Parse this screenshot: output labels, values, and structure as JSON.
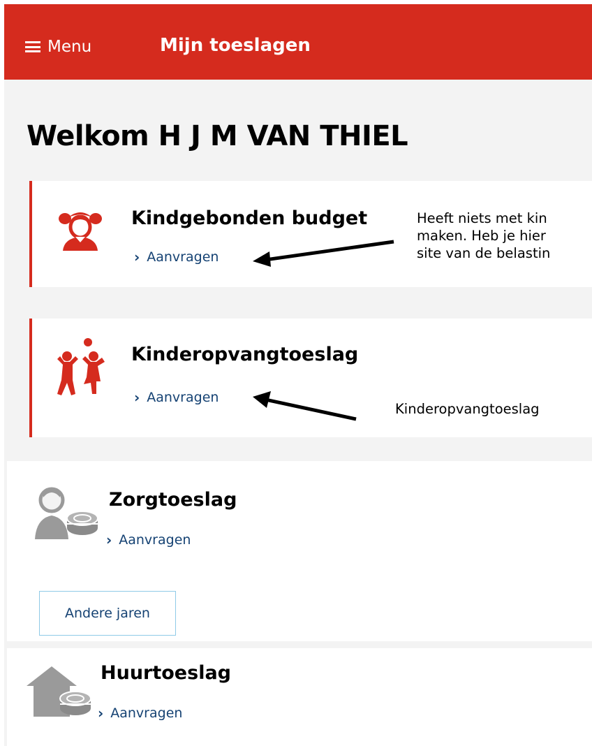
{
  "header": {
    "menu_label": "Menu",
    "app_title": "Mijn toeslagen",
    "brand_color": "#d52b1e"
  },
  "welcome": "Welkom H J M VAN THIEL",
  "cards": [
    {
      "title": "Kindgebonden budget",
      "link": "Aanvragen",
      "icon": "girl-icon",
      "note": "Heeft niets met kin\nmaken. Heb je hier\nsite van de belastin"
    },
    {
      "title": "Kinderopvangtoeslag",
      "link": "Aanvragen",
      "icon": "children-playing-icon",
      "note": "Kinderopvangtoeslag"
    },
    {
      "title": "Zorgtoeslag",
      "link": "Aanvragen",
      "icon": "health-coins-icon",
      "extra_button": "Andere jaren"
    },
    {
      "title": "Huurtoeslag",
      "link": "Aanvragen",
      "icon": "house-coins-icon"
    }
  ],
  "colors": {
    "link": "#154273",
    "accent_border": "#d52b1e",
    "outline_button_border": "#8fcae7",
    "page_background": "#f3f3f3"
  }
}
